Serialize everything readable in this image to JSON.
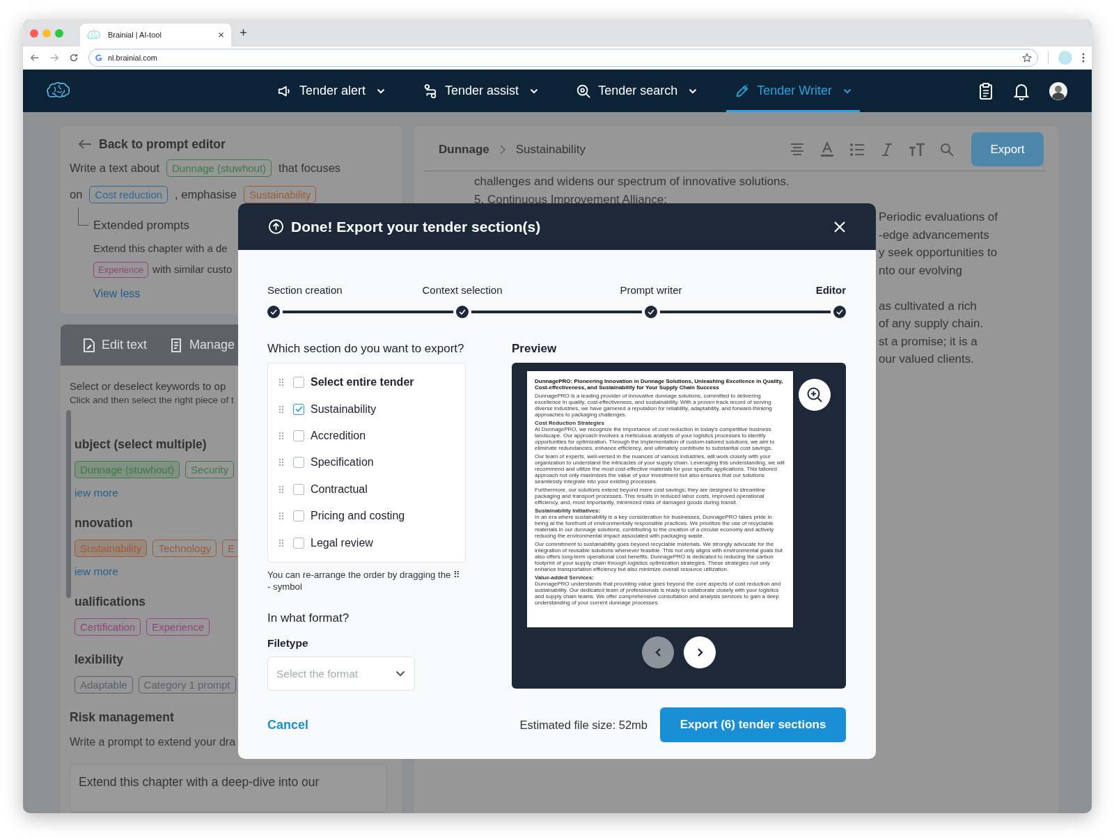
{
  "browser": {
    "tab_title": "Brainial | AI-tool",
    "tab_close": "×",
    "new_tab": "+",
    "url": "nl.brainial.com"
  },
  "nav": {
    "items": [
      {
        "label": "Tender alert",
        "selected": false
      },
      {
        "label": "Tender assist",
        "selected": false
      },
      {
        "label": "Tender search",
        "selected": false
      },
      {
        "label": "Tender Writer",
        "selected": true
      }
    ]
  },
  "prompt_card": {
    "back": "Back to prompt editor",
    "lines": [
      [
        {
          "kind": "text",
          "text": "Write a text about"
        },
        {
          "kind": "tag",
          "text": "Dunnage (stuwhout)",
          "color": "#3d7a45"
        },
        {
          "kind": "text",
          "text": "that focuses"
        }
      ],
      [
        {
          "kind": "text",
          "text": "on"
        },
        {
          "kind": "tag",
          "text": "Cost reduction",
          "color": "#2f6a96"
        },
        {
          "kind": "text",
          "text": ", emphasise"
        },
        {
          "kind": "tag",
          "text": "Sustainability",
          "color": "#9e5a34"
        }
      ]
    ],
    "extended_title": "Extended prompts",
    "extended_lines": [
      [
        {
          "kind": "text",
          "text": "Extend this chapter with a de"
        }
      ],
      [
        {
          "kind": "tag",
          "text": "Experience",
          "color": "#94437d"
        },
        {
          "kind": "text",
          "text": "with similar custo"
        }
      ]
    ],
    "toggle": "View less"
  },
  "editor_tabs": [
    {
      "label": "Edit text"
    },
    {
      "label": "Manage"
    }
  ],
  "keywords": {
    "intro": "Select or deselect keywords to op",
    "hint": "Click and then select the right piece of t",
    "groups": [
      {
        "title": "ubject (select multiple)",
        "more": "iew more",
        "tags": [
          {
            "text": "Dunnage (stuwhout)",
            "color": "#3d7a45",
            "selected": true
          },
          {
            "text": "Security",
            "color": "#3d7a45",
            "selected": false
          }
        ]
      },
      {
        "title": "nnovation",
        "more": "iew more",
        "tags": [
          {
            "text": "Sustainability",
            "color": "#9e5a34",
            "selected": true
          },
          {
            "text": "Technology",
            "color": "#9e5a34",
            "selected": false
          },
          {
            "text": "E",
            "color": "#9e5a34",
            "selected": false
          }
        ]
      },
      {
        "title": "ualifications",
        "tags": [
          {
            "text": "Certification",
            "color": "#94437d",
            "selected": false
          },
          {
            "text": "Experience",
            "color": "#94437d",
            "selected": false
          }
        ]
      },
      {
        "title": "lexibility",
        "tags": [
          {
            "text": "Adaptable",
            "color": "#5c6066",
            "selected": false
          },
          {
            "text": "Category 1 prompt",
            "color": "#5c6066",
            "selected": false
          }
        ]
      }
    ]
  },
  "risk": {
    "title": "Risk management",
    "hint": "Write a prompt to extend your dra",
    "prompt": "Extend this chapter with a deep-dive into our"
  },
  "editor": {
    "breadcrumb": [
      "Dunnage",
      "Sustainability"
    ],
    "export": "Export",
    "lines": [
      "challenges and widens our spectrum of innovative solutions.",
      "5. Continuous Improvement Alliance:"
    ],
    "fragments": [
      [
        "Periodic evaluations of",
        "-edge advancements",
        "y seek opportunities to",
        "nto our evolving"
      ],
      [
        "as cultivated a rich",
        "of any supply chain.",
        "st a promise; it is a",
        "our valued clients."
      ]
    ]
  },
  "modal": {
    "title": "Done! Export your tender section(s)",
    "steps": [
      {
        "label": "Section creation",
        "done": true,
        "selected": false
      },
      {
        "label": "Context selection",
        "done": true,
        "selected": false
      },
      {
        "label": "Prompt writer",
        "done": true,
        "selected": false
      },
      {
        "label": "Editor",
        "done": true,
        "selected": true
      }
    ],
    "question": "Which section do you want to export?",
    "sections": [
      {
        "kind": "all",
        "label": "Select entire tender",
        "checked": false
      },
      {
        "kind": "section",
        "label": "Sustainability",
        "checked": true
      },
      {
        "kind": "section",
        "label": "Accredition",
        "checked": false
      },
      {
        "kind": "section",
        "label": "Specification",
        "checked": false
      },
      {
        "kind": "section",
        "label": "Contractual",
        "checked": false
      },
      {
        "kind": "section",
        "label": "Pricing and costing",
        "checked": false
      },
      {
        "kind": "section",
        "label": "Legal review",
        "checked": false
      }
    ],
    "hint": "You can re-arrange the order by dragging the ⠿ - symbol",
    "format_title": "In what format?",
    "filetype_label": "Filetype",
    "filetype": {
      "placeholder": "Select the format"
    },
    "preview_title": "Preview",
    "document": [
      {
        "kind": "title",
        "text": "DunnagePRO: Pioneering Innovation in Dunnage Solutions, Unleashing Excellence in Quality, Cost-effectiveness, and Sustainability for Your Supply Chain Success"
      },
      {
        "kind": "p",
        "text": "DunnagePRO is a leading provider of innovative dunnage solutions, committed to delivering excellence in quality, cost-effectiveness, and sustainability. With a proven track record of serving diverse industries, we have garnered a reputation for reliability, adaptability, and forward-thinking approaches to packaging challenges."
      },
      {
        "kind": "h",
        "text": "Cost Reduction Strategies"
      },
      {
        "kind": "p",
        "text": "At DunnagePRO, we recognize the importance of cost reduction in today's competitive business landscape. Our approach involves a meticulous analysis of your logistics processes to identify opportunities for optimization. Through the implementation of custom-tailored solutions, we aim to eliminate redundancies, enhance efficiency, and ultimately contribute to substantial cost savings."
      },
      {
        "kind": "p",
        "text": "Our team of experts, well-versed in the nuances of various industries, will work closely with your organization to understand the intricacies of your supply chain. Leveraging this understanding, we will recommend and utilize the most cost-effective materials for your specific applications. This tailored approach not only maximizes the value of your investment but also ensures that our solutions seamlessly integrate into your existing processes."
      },
      {
        "kind": "p",
        "text": "Furthermore, our solutions extend beyond mere cost savings; they are designed to streamline packaging and transport processes. This results in reduced labor costs, improved operational efficiency, and, most importantly, minimized risks of damaged goods during transit."
      },
      {
        "kind": "h",
        "text": "Sustainability Initiatives:"
      },
      {
        "kind": "p",
        "text": "In an era where sustainability is a key consideration for businesses, DunnagePRO takes pride in being at the forefront of environmentally responsible practices. We prioritize the use of recyclable materials in our dunnage solutions, contributing to the creation of a circular economy and actively reducing the environmental impact associated with packaging waste."
      },
      {
        "kind": "p",
        "text": "Our commitment to sustainability goes beyond recyclable materials. We strongly advocate for the integration of reusable solutions whenever feasible. This not only aligns with environmental goals but also offers long-term operational cost benefits. DunnagePRO is dedicated to reducing the carbon footprint of your supply chain through logistics optimization strategies. These strategies not only enhance transportation efficiency but also minimize overall resource utilization."
      },
      {
        "kind": "h",
        "text": "Value-added Services:"
      },
      {
        "kind": "p",
        "text": "DunnagePRO understands that providing value goes beyond the core aspects of cost reduction and sustainability. Our dedicated team of professionals is ready to collaborate closely with your logistics and supply chain teams. We offer comprehensive consultation and analysis services to gain a deep understanding of your current dunnage processes."
      }
    ],
    "pager": {
      "prev_enabled": false,
      "next_enabled": true
    },
    "cancel": "Cancel",
    "estimate": "Estimated file size: 52mb",
    "export": "Export (6) tender sections"
  }
}
